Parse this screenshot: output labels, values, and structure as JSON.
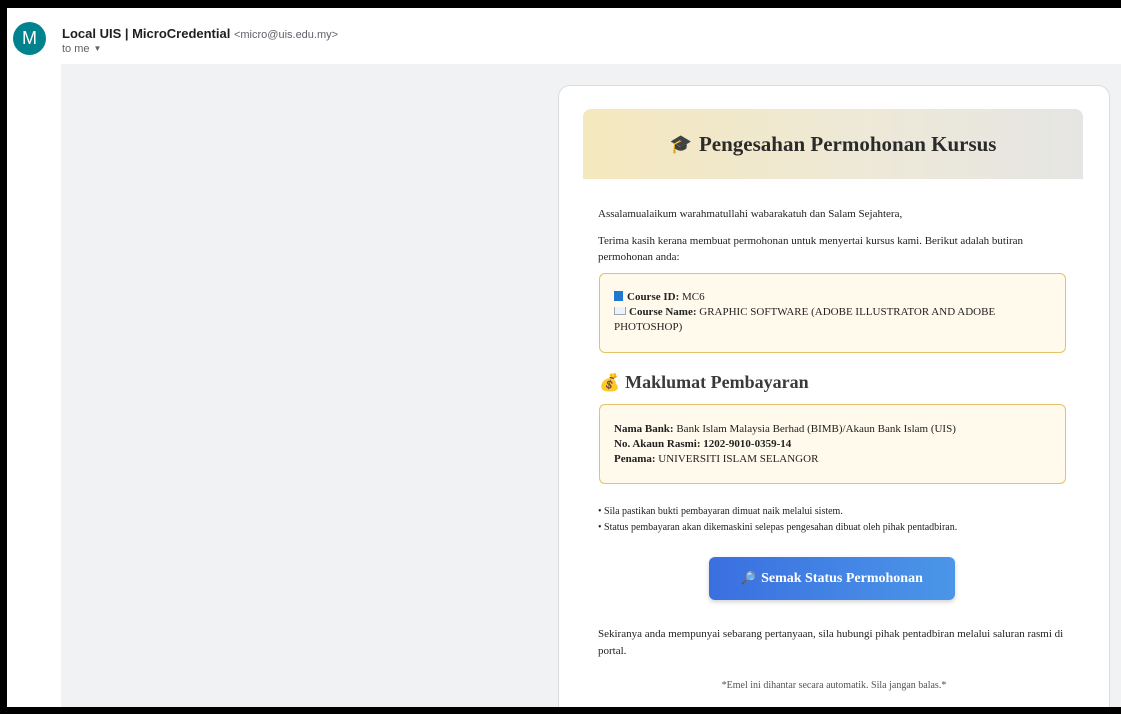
{
  "sender": {
    "avatar_letter": "M",
    "name": "Local UIS | MicroCredential",
    "email": "<micro@uis.edu.my>",
    "to": "to me",
    "avatar_color": "#00838f"
  },
  "email": {
    "banner_icon": "🎓",
    "title": "Pengesahan Permohonan Kursus",
    "greeting": "Assalamualaikum warahmatullahi wabarakatuh dan Salam Sejahtera,",
    "intro": "Terima kasih kerana membuat permohonan untuk menyertai kursus kami. Berikut adalah butiran permohonan anda:",
    "course": {
      "id_label": "Course ID:",
      "id_value": "MC6",
      "name_label": "Course Name:",
      "name_value": "GRAPHIC SOFTWARE (ADOBE ILLUSTRATOR AND ADOBE PHOTOSHOP)"
    },
    "payment_section": {
      "icon": "💰",
      "title": "Maklumat Pembayaran",
      "bank_label": "Nama Bank:",
      "bank_value": "Bank Islam Malaysia Berhad (BIMB)/Akaun Bank Islam (UIS)",
      "account_label": "No. Akaun Rasmi:",
      "account_value": "1202-9010-0359-14",
      "payee_label": "Penama:",
      "payee_value": "UNIVERSITI ISLAM SELANGOR"
    },
    "notes": [
      "• Sila pastikan bukti pembayaran dimuat naik melalui sistem.",
      "• Status pembayaran akan dikemaskini selepas pengesahan dibuat oleh pihak pentadbiran."
    ],
    "button": {
      "icon": "🔎",
      "label": "Semak Status Permohonan"
    },
    "closing": "Sekiranya anda mempunyai sebarang pertanyaan, sila hubungi pihak pentadbiran melalui saluran rasmi di portal.",
    "footer": "*Emel ini dihantar secara automatik. Sila jangan balas.*"
  },
  "colors": {
    "button_gradient_start": "#3a6fe0",
    "button_gradient_end": "#4b96e8",
    "box_border": "#e5c16a",
    "box_background": "#fffaec"
  }
}
